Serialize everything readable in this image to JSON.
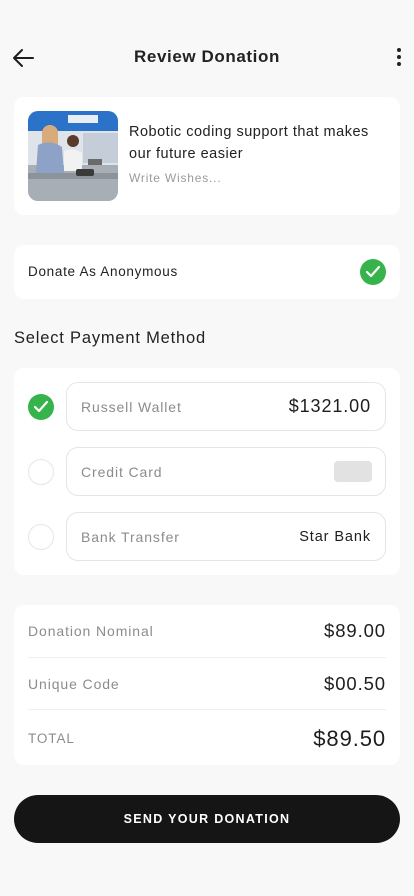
{
  "header": {
    "title": "Review Donation",
    "back_icon": "arrow-left-icon",
    "more_icon": "more-vertical-icon"
  },
  "campaign": {
    "title": "Robotic coding support that makes our future easier",
    "wish_placeholder": "Write Wishes..."
  },
  "anonymous": {
    "label": "Donate As Anonymous",
    "checked": true
  },
  "payment": {
    "section_title": "Select Payment Method",
    "methods": [
      {
        "label": "Russell Wallet",
        "value": "$1321.00",
        "selected": true
      },
      {
        "label": "Credit Card",
        "value": "",
        "selected": false
      },
      {
        "label": "Bank Transfer",
        "value": "Star Bank",
        "selected": false
      }
    ]
  },
  "summary": {
    "rows": [
      {
        "label": "Donation Nominal",
        "value": "$89.00"
      },
      {
        "label": "Unique Code",
        "value": "$00.50"
      },
      {
        "label": "TOTAL",
        "value": "$89.50"
      }
    ]
  },
  "cta": {
    "label": "SEND YOUR DONATION"
  },
  "colors": {
    "accent_green": "#36b34a",
    "button_dark": "#151515",
    "background": "#f8f8f8"
  }
}
